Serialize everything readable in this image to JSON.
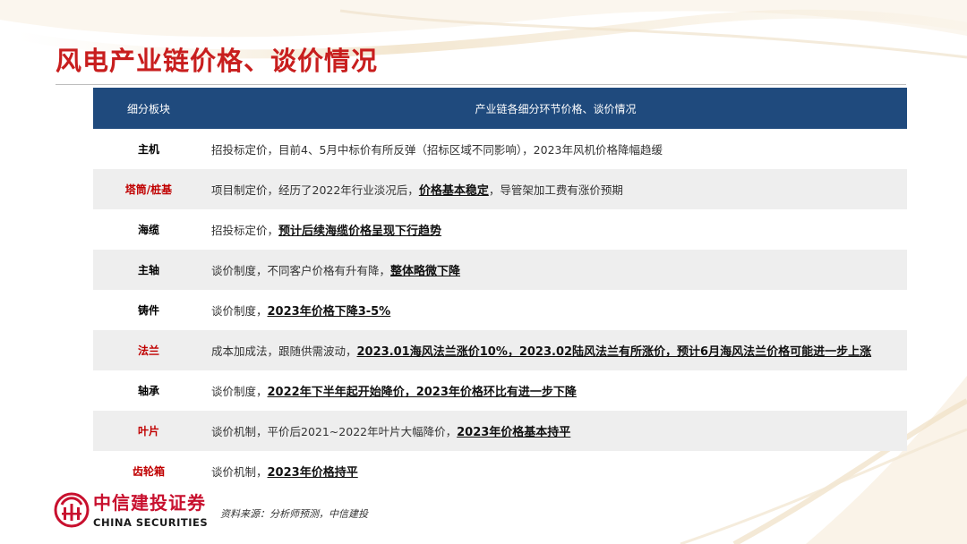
{
  "title": "风电产业链价格、谈价情况",
  "table": {
    "headers": [
      "细分板块",
      "产业链各细分环节价格、谈价情况"
    ],
    "rows": [
      {
        "segment": "主机",
        "seg_color": "black",
        "plain": "招投标定价，目前4、5月中标价有所反弹（招标区域不同影响），2023年风机价格降幅趋缓",
        "emph": "",
        "tail": ""
      },
      {
        "segment": "塔筒/桩基",
        "seg_color": "red",
        "plain": "项目制定价，经历了2022年行业淡况后，",
        "emph": "价格基本稳定",
        "tail": "，导管架加工费有涨价预期"
      },
      {
        "segment": "海缆",
        "seg_color": "black",
        "plain": "招投标定价，",
        "emph": "预计后续海缆价格呈现下行趋势",
        "tail": ""
      },
      {
        "segment": "主轴",
        "seg_color": "black",
        "plain": "谈价制度，不同客户价格有升有降，",
        "emph": "整体略微下降",
        "tail": ""
      },
      {
        "segment": "铸件",
        "seg_color": "black",
        "plain": "谈价制度，",
        "emph": "2023年价格下降3-5%",
        "tail": ""
      },
      {
        "segment": "法兰",
        "seg_color": "red",
        "plain": "成本加成法，跟随供需波动，",
        "emph": "2023.01海风法兰涨价10%，2023.02陆风法兰有所涨价，预计6月海风法兰价格可能进一步上涨",
        "tail": ""
      },
      {
        "segment": "轴承",
        "seg_color": "black",
        "plain": "谈价制度，",
        "emph": "2022年下半年起开始降价，2023年价格环比有进一步下降",
        "tail": ""
      },
      {
        "segment": "叶片",
        "seg_color": "red",
        "plain": "谈价机制，平价后2021~2022年叶片大幅降价，",
        "emph": "2023年价格基本持平",
        "tail": ""
      },
      {
        "segment": "齿轮箱",
        "seg_color": "red",
        "plain": "谈价机制，",
        "emph": "2023年价格持平",
        "tail": ""
      }
    ]
  },
  "footer": {
    "logo_icon": "citic-logo-icon",
    "logo_cn": "中信建投证券",
    "logo_en": "CHINA SECURITIES",
    "source": "资料来源：分析师预测，中信建投"
  },
  "colors": {
    "accent_red": "#c81e1e",
    "header_blue": "#1f4a7d",
    "row_shade": "#eeeeee"
  }
}
